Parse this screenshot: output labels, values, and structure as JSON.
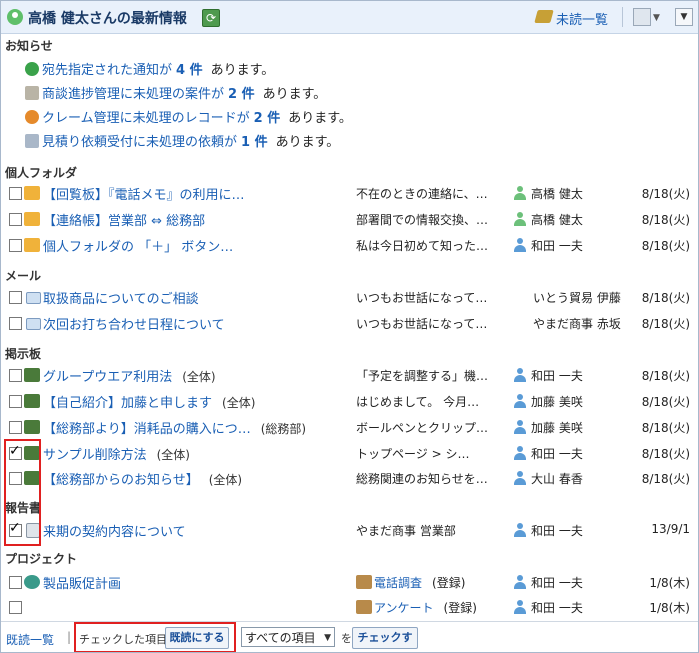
{
  "header": {
    "title": "高橋 健太さんの最新情報",
    "unread_list": "未読一覧"
  },
  "sections": {
    "notice": "お知らせ",
    "personal": "個人フォルダ",
    "mail": "メール",
    "board": "掲示板",
    "report": "報告書",
    "project": "プロジェクト"
  },
  "notices": [
    {
      "pre": "宛先指定された通知が",
      "count": "4 件",
      "post": "あります。"
    },
    {
      "pre": "商談進捗管理に未処理の案件が",
      "count": "2 件",
      "post": "あります。"
    },
    {
      "pre": "クレーム管理に未処理のレコードが",
      "count": "2 件",
      "post": "あります。"
    },
    {
      "pre": "見積り依頼受付に未処理の依頼が",
      "count": "1 件",
      "post": "あります。"
    }
  ],
  "personal_rows": [
    {
      "title": "【回覧板】『電話メモ』の利用に…",
      "snippet": "不在のときの連絡に、…",
      "sender": "高橋 健太",
      "date": "8/18(火)"
    },
    {
      "title": "【連絡帳】営業部 ⇔ 総務部",
      "snippet": "部署間での情報交換、…",
      "sender": "高橋 健太",
      "date": "8/18(火)"
    },
    {
      "title": "個人フォルダの 「＋」 ボタン…",
      "snippet": "私は今日初めて知った…",
      "sender": "和田 一夫",
      "date": "8/18(火)"
    }
  ],
  "mail_rows": [
    {
      "title": "取扱商品についてのご相談",
      "snippet": "いつもお世話になって…",
      "sender": "いとう貿易 伊藤",
      "date": "8/18(火)"
    },
    {
      "title": "次回お打ち合わせ日程について",
      "snippet": "いつもお世話になって…",
      "sender": "やまだ商事 赤坂",
      "date": "8/18(火)"
    }
  ],
  "board_rows": [
    {
      "title": "グループウエア利用法",
      "sub": "(全体)",
      "snippet": "「予定を調整する」機…",
      "sender": "和田 一夫",
      "date": "8/18(火)"
    },
    {
      "title": "【自己紹介】加藤と申します",
      "sub": "(全体)",
      "snippet": "はじめまして。 今月…",
      "sender": "加藤 美咲",
      "date": "8/18(火)"
    },
    {
      "title": "【総務部より】消耗品の購入につ…",
      "sub": "(総務部)",
      "snippet": "ボールペンとクリップ…",
      "sender": "加藤 美咲",
      "date": "8/18(火)"
    },
    {
      "title": "サンプル削除方法",
      "sub": "(全体)",
      "snippet": "トップページ > シ…",
      "sender": "和田 一夫",
      "date": "8/18(火)"
    },
    {
      "title": "【総務部からのお知らせ】",
      "sub": "(全体)",
      "snippet": "総務関連のお知らせを…",
      "sender": "大山 春香",
      "date": "8/18(火)"
    }
  ],
  "report_rows": [
    {
      "title": "来期の契約内容について",
      "snippet": "やまだ商事 営業部",
      "sender": "和田 一夫",
      "date": "13/9/1"
    }
  ],
  "project_rows": [
    {
      "title": "製品販促計画",
      "sub_title": "電話調査",
      "sub_paren": "(登録)",
      "sender": "和田 一夫",
      "date": "1/8(木)"
    },
    {
      "title": "",
      "sub_title": "アンケート",
      "sub_paren": "(登録)",
      "sender": "和田 一夫",
      "date": "1/8(木)"
    }
  ],
  "footer": {
    "read_list": "既読一覧",
    "checked_label": "チェックした項目を",
    "mark_read": "既読にする",
    "select_value": "すべての項目",
    "wo": "を",
    "check": "チェックする"
  },
  "colors": {
    "accent": "#1a5fb4",
    "highlight": "#e02020",
    "header_bg": "#e9f1fb"
  }
}
